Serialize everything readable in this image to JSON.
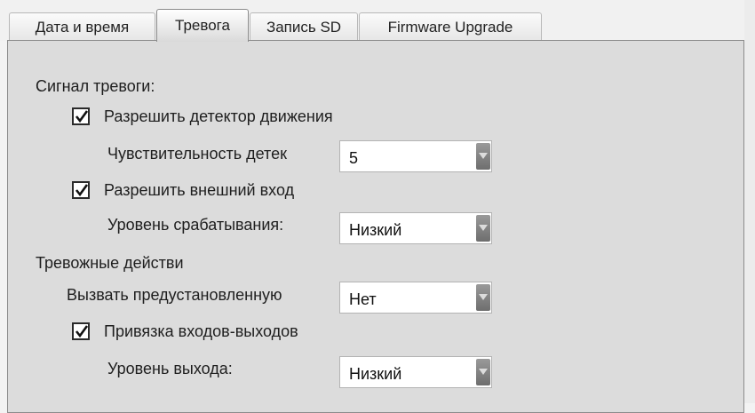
{
  "tabs": [
    {
      "label": "Дата и время",
      "active": false
    },
    {
      "label": "Тревога",
      "active": true
    },
    {
      "label": "Запись SD",
      "active": false
    },
    {
      "label": "Firmware Upgrade",
      "active": false
    }
  ],
  "alarm_section": {
    "title": "Сигнал тревоги:",
    "motion_detector": {
      "label": "Разрешить детектор движения",
      "checked": true
    },
    "sensitivity": {
      "label": "Чувствительность детек",
      "value": "5"
    },
    "external_input": {
      "label": "Разрешить внешний вход",
      "checked": true
    },
    "trigger_level": {
      "label": "Уровень срабатывания:",
      "value": "Низкий"
    }
  },
  "actions_section": {
    "title": "Тревожные действи",
    "preset": {
      "label": "Вызвать предустановленную",
      "value": "Нет"
    },
    "io_binding": {
      "label": "Привязка входов-выходов",
      "checked": true
    },
    "output_level": {
      "label": "Уровень выхода:",
      "value": "Низкий"
    }
  },
  "colors": {
    "panel": "#dcdcdc",
    "checkbox_border": "#2a2a2a",
    "arrow": "#7a7a7a"
  }
}
